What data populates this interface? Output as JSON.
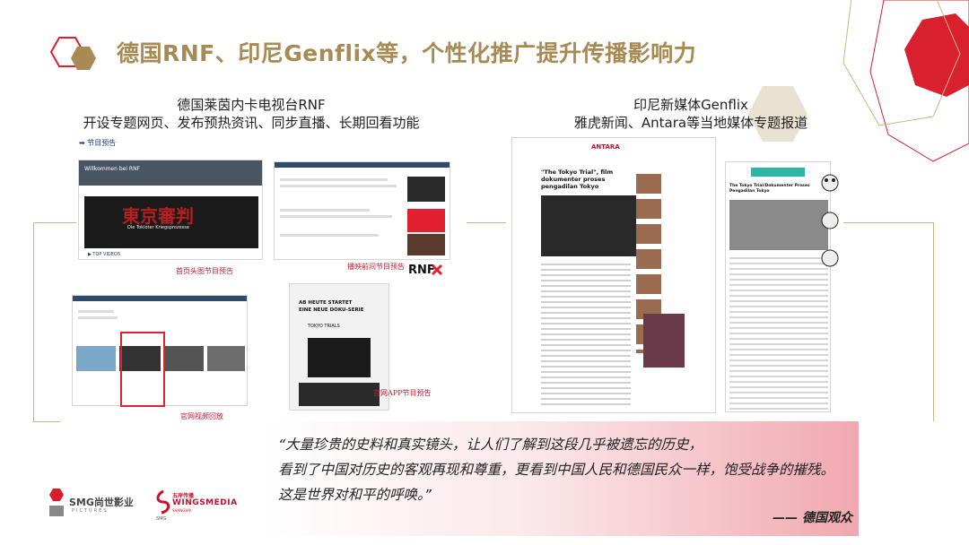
{
  "title": "德国RNF、印尼Genflix等，个性化推广提升传播影响力",
  "left_caption": {
    "line1": "德国莱茵内卡电视台RNF",
    "line2": "开设专题网页、发布预热资讯、同步直播、长期回看功能"
  },
  "right_caption": {
    "line1": "印尼新媒体Genflix",
    "line2": "雅虎新闻、Antara等当地媒体专题报道"
  },
  "left_nav_tag": "➡ 节目预告",
  "screenshot_labels": {
    "homepage": "首页头图节目预告",
    "broadcast": "播映前间节目预告",
    "video": "官网视频回放",
    "app": "官网APP节目预告"
  },
  "shot_texts": {
    "rnf_banner": "Willkommen bei RNF",
    "rnf_title": "東京審判",
    "rnf_subtitle": "Die Tokioter Kriegsprozesse",
    "rnf_app_line1": "AB HEUTE STARTET",
    "rnf_app_line2": "EINE NEUE DOKU-SERIE",
    "rnf_app_line3": "TOKYO TRIALS",
    "rnf_logo": "RNF",
    "antara_headline": "\"The Tokyo Trial\", film dokumenter proses pengadilan Tokyo",
    "antara_logo": "ANTARA",
    "yahoo_headline": "The Tokyo Trial/Dokumenter Proses Pengadilan Tokyo",
    "top_videos": "▶ TOP VIDEOS"
  },
  "quote": {
    "line1": "“大量珍贵的史料和真实镜头，让人们了解到这段几乎被遗忘的历史，",
    "line2": "看到了中国对历史的客观再现和尊重，更看到中国人民和德国民众一样，饱受战争的摧残。",
    "line3": "这是世界对和平的呼唤。”",
    "source": "—— 德国观众"
  },
  "logos": {
    "smg_text": "SMG尚世影业",
    "smg_sub": "PICTURES",
    "wings_top": "五岸传播",
    "wings_main": "WINGSMEDIA",
    "wings_sub": "SHANGHAI",
    "wings_smg": "SMG"
  },
  "colors": {
    "title": "#a88a55",
    "accent_red": "#d8202f",
    "gold": "#c9b58a"
  }
}
